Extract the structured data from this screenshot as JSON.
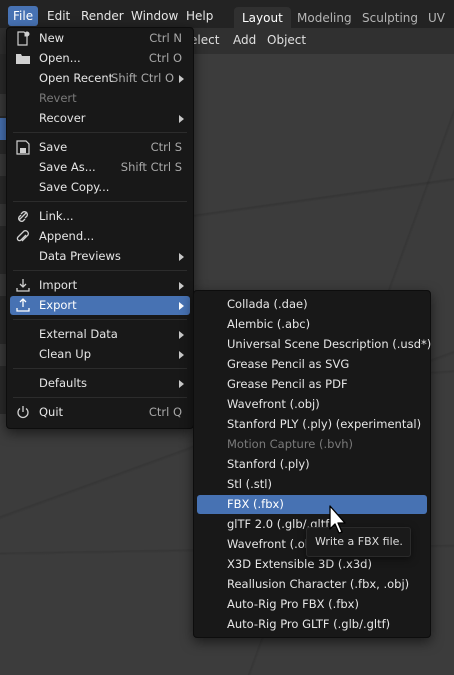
{
  "topbar": {
    "menus": [
      "File",
      "Edit",
      "Render",
      "Window",
      "Help"
    ],
    "workspaces": [
      "Layout",
      "Modeling",
      "Sculpting",
      "UV Ed"
    ]
  },
  "header": {
    "menus": [
      "elect",
      "Add",
      "Object"
    ]
  },
  "file_menu": {
    "new": {
      "label": "New",
      "shortcut": "Ctrl N",
      "icon": "new-file-icon"
    },
    "open": {
      "label": "Open...",
      "shortcut": "Ctrl O",
      "icon": "folder-icon"
    },
    "open_recent": {
      "label": "Open Recent",
      "shortcut": "Shift Ctrl O"
    },
    "revert": {
      "label": "Revert"
    },
    "recover": {
      "label": "Recover"
    },
    "save": {
      "label": "Save",
      "shortcut": "Ctrl S",
      "icon": "save-icon"
    },
    "save_as": {
      "label": "Save As...",
      "shortcut": "Shift Ctrl S"
    },
    "save_copy": {
      "label": "Save Copy..."
    },
    "link": {
      "label": "Link...",
      "icon": "link-icon"
    },
    "append": {
      "label": "Append...",
      "icon": "paperclip-icon"
    },
    "data_previews": {
      "label": "Data Previews"
    },
    "import": {
      "label": "Import",
      "icon": "import-icon"
    },
    "export": {
      "label": "Export",
      "icon": "export-icon"
    },
    "external_data": {
      "label": "External Data"
    },
    "clean_up": {
      "label": "Clean Up"
    },
    "defaults": {
      "label": "Defaults"
    },
    "quit": {
      "label": "Quit",
      "shortcut": "Ctrl Q",
      "icon": "power-icon"
    }
  },
  "export_menu": {
    "items": [
      "Collada (.dae)",
      "Alembic (.abc)",
      "Universal Scene Description (.usd*)",
      "Grease Pencil as SVG",
      "Grease Pencil as PDF",
      "Wavefront (.obj)",
      "Stanford PLY (.ply) (experimental)",
      "Motion Capture (.bvh)",
      "Stanford (.ply)",
      "Stl (.stl)",
      "FBX (.fbx)",
      "glTF 2.0 (.glb/.gltf)",
      "Wavefront (.obj",
      "X3D Extensible 3D (.x3d)",
      "Reallusion Character (.fbx, .obj)",
      "Auto-Rig Pro FBX (.fbx)",
      "Auto-Rig Pro GLTF (.glb/.gltf)"
    ],
    "highlighted": "FBX (.fbx)",
    "disabled": "Motion Capture (.bvh)"
  },
  "tooltip": {
    "text": "Write a FBX file."
  },
  "colors": {
    "highlight": "#4772b3",
    "menu_bg": "#181818",
    "viewport": "#3c3c3c"
  }
}
